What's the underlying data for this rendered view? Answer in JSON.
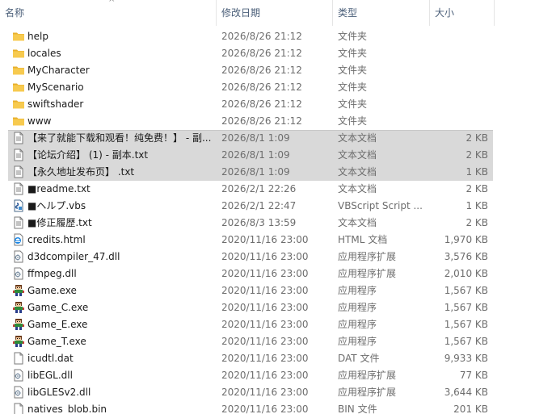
{
  "columns": {
    "name": "名称",
    "date": "修改日期",
    "type": "类型",
    "size": "大小"
  },
  "sort_indicator": "^",
  "files": [
    {
      "name": "help",
      "date": "2026/8/26 21:12",
      "type": "文件夹",
      "size": "",
      "icon": "folder-icon",
      "selected": false
    },
    {
      "name": "locales",
      "date": "2026/8/26 21:12",
      "type": "文件夹",
      "size": "",
      "icon": "folder-icon",
      "selected": false
    },
    {
      "name": "MyCharacter",
      "date": "2026/8/26 21:12",
      "type": "文件夹",
      "size": "",
      "icon": "folder-icon",
      "selected": false
    },
    {
      "name": "MyScenario",
      "date": "2026/8/26 21:12",
      "type": "文件夹",
      "size": "",
      "icon": "folder-icon",
      "selected": false
    },
    {
      "name": "swiftshader",
      "date": "2026/8/26 21:12",
      "type": "文件夹",
      "size": "",
      "icon": "folder-icon",
      "selected": false
    },
    {
      "name": "www",
      "date": "2026/8/26 21:12",
      "type": "文件夹",
      "size": "",
      "icon": "folder-icon",
      "selected": false
    },
    {
      "name": "【来了就能下载和观看！纯免费！】 - 副...",
      "date": "2026/8/1 1:09",
      "type": "文本文档",
      "size": "2 KB",
      "icon": "text-file-icon",
      "selected": true
    },
    {
      "name": "【论坛介绍】 (1) - 副本.txt",
      "date": "2026/8/1 1:09",
      "type": "文本文档",
      "size": "2 KB",
      "icon": "text-file-icon",
      "selected": true
    },
    {
      "name": "【永久地址发布页】 .txt",
      "date": "2026/8/1 1:09",
      "type": "文本文档",
      "size": "1 KB",
      "icon": "text-file-icon",
      "selected": true
    },
    {
      "name": "■readme.txt",
      "date": "2026/2/1 22:26",
      "type": "文本文档",
      "size": "2 KB",
      "icon": "text-file-icon",
      "selected": false
    },
    {
      "name": "■ヘルプ.vbs",
      "date": "2026/2/1 22:47",
      "type": "VBScript Script ...",
      "size": "1 KB",
      "icon": "vbscript-icon",
      "selected": false
    },
    {
      "name": "■修正履歴.txt",
      "date": "2026/8/3 13:59",
      "type": "文本文档",
      "size": "2 KB",
      "icon": "text-file-icon",
      "selected": false
    },
    {
      "name": "credits.html",
      "date": "2020/11/16 23:00",
      "type": "HTML 文档",
      "size": "1,970 KB",
      "icon": "html-file-icon",
      "selected": false
    },
    {
      "name": "d3dcompiler_47.dll",
      "date": "2020/11/16 23:00",
      "type": "应用程序扩展",
      "size": "3,576 KB",
      "icon": "dll-file-icon",
      "selected": false
    },
    {
      "name": "ffmpeg.dll",
      "date": "2020/11/16 23:00",
      "type": "应用程序扩展",
      "size": "2,010 KB",
      "icon": "dll-file-icon",
      "selected": false
    },
    {
      "name": "Game.exe",
      "date": "2020/11/16 23:00",
      "type": "应用程序",
      "size": "1,567 KB",
      "icon": "game-exe-icon",
      "selected": false
    },
    {
      "name": "Game_C.exe",
      "date": "2020/11/16 23:00",
      "type": "应用程序",
      "size": "1,567 KB",
      "icon": "game-exe-icon",
      "selected": false
    },
    {
      "name": "Game_E.exe",
      "date": "2020/11/16 23:00",
      "type": "应用程序",
      "size": "1,567 KB",
      "icon": "game-exe-icon",
      "selected": false
    },
    {
      "name": "Game_T.exe",
      "date": "2020/11/16 23:00",
      "type": "应用程序",
      "size": "1,567 KB",
      "icon": "game-exe-icon",
      "selected": false
    },
    {
      "name": "icudtl.dat",
      "date": "2020/11/16 23:00",
      "type": "DAT 文件",
      "size": "9,933 KB",
      "icon": "blank-file-icon",
      "selected": false
    },
    {
      "name": "libEGL.dll",
      "date": "2020/11/16 23:00",
      "type": "应用程序扩展",
      "size": "77 KB",
      "icon": "dll-file-icon",
      "selected": false
    },
    {
      "name": "libGLESv2.dll",
      "date": "2020/11/16 23:00",
      "type": "应用程序扩展",
      "size": "3,644 KB",
      "icon": "dll-file-icon",
      "selected": false
    },
    {
      "name": "natives_blob.bin",
      "date": "2020/11/16 23:00",
      "type": "BIN 文件",
      "size": "201 KB",
      "icon": "blank-file-icon",
      "selected": false
    }
  ],
  "colors": {
    "header_text": "#4c607a",
    "selection": "#d9d9d9",
    "folder": "#f5c242",
    "secondary_text": "#6d6d6d"
  }
}
